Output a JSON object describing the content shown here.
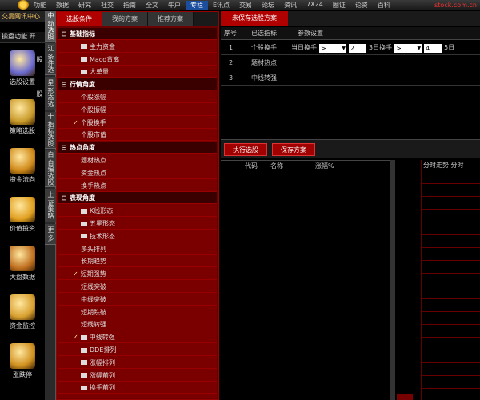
{
  "toolbar": {
    "items": [
      "功能",
      "数据",
      "研究",
      "社交",
      "指南",
      "全文",
      "牛户",
      "专栏",
      "E讯点",
      "交易",
      "论坛",
      "资讯",
      "7X24",
      "圈证",
      "论资",
      "百科"
    ],
    "active_index": 7,
    "brand": "stock.com.cn"
  },
  "left": {
    "title": "交易网讯中心",
    "subtitle": "操盘功能 开",
    "apps": [
      {
        "label": "选股设置",
        "icon": "diamond-icon",
        "color": "#6a6ad0"
      },
      {
        "label": "策略选股",
        "icon": "portfolio-icon",
        "color": "#c89a2a"
      },
      {
        "label": "资金流向",
        "icon": "coins-icon",
        "color": "#d08a1a"
      },
      {
        "label": "价值投资",
        "icon": "pe-icon",
        "color": "#e0a020"
      },
      {
        "label": "大盘数据",
        "icon": "calendar-icon",
        "color": "#c07020"
      },
      {
        "label": "资金监控",
        "icon": "money-icon",
        "color": "#d8a030"
      },
      {
        "label": "涨跌停",
        "icon": "gold-icon",
        "color": "#d09020"
      }
    ]
  },
  "vtabs": [
    "中 动选股",
    "江 条件选股",
    "星 形态选股",
    "十 指标选股",
    "白 自编选股",
    "上 证策略",
    "更 多"
  ],
  "panel": {
    "tabs": [
      "选股条件",
      "我的方案",
      "推荐方案"
    ],
    "tree": [
      {
        "type": "group",
        "label": "基础指标"
      },
      {
        "type": "leaf-folder",
        "label": "主力资金"
      },
      {
        "type": "leaf-folder",
        "label": "Macd背离"
      },
      {
        "type": "leaf-folder",
        "label": "大单量"
      },
      {
        "type": "group",
        "label": "行情角度"
      },
      {
        "type": "leaf",
        "label": "个股涨幅"
      },
      {
        "type": "leaf",
        "label": "个股振幅"
      },
      {
        "type": "leaf",
        "label": "个股换手",
        "checked": true
      },
      {
        "type": "leaf",
        "label": "个股市值"
      },
      {
        "type": "group",
        "label": "热点角度"
      },
      {
        "type": "leaf",
        "label": "题材热点"
      },
      {
        "type": "leaf",
        "label": "资金热点"
      },
      {
        "type": "leaf",
        "label": "换手热点"
      },
      {
        "type": "group",
        "label": "表现角度"
      },
      {
        "type": "leaf-folder",
        "label": "K线形态"
      },
      {
        "type": "leaf-folder",
        "label": "五星形态"
      },
      {
        "type": "leaf-folder",
        "label": "技术形态"
      },
      {
        "type": "leaf",
        "label": "多头排列"
      },
      {
        "type": "leaf",
        "label": "长期趋势"
      },
      {
        "type": "leaf",
        "label": "短期强势",
        "checked": true
      },
      {
        "type": "leaf",
        "label": "短线突破"
      },
      {
        "type": "leaf",
        "label": "中线突破"
      },
      {
        "type": "leaf",
        "label": "短期跌破"
      },
      {
        "type": "leaf",
        "label": "短线转强"
      },
      {
        "type": "leaf-folder",
        "label": "中线转强",
        "checked": true
      },
      {
        "type": "leaf-folder",
        "label": "DDE排列"
      },
      {
        "type": "leaf-folder",
        "label": "涨幅排列"
      },
      {
        "type": "leaf-folder",
        "label": "涨幅前列"
      },
      {
        "type": "leaf-folder",
        "label": "换手前列"
      }
    ]
  },
  "right": {
    "tab": "未保存选股方案",
    "columns": [
      "序号",
      "已选指标",
      "参数设置"
    ],
    "rows": [
      {
        "num": "1",
        "name": "个股换手",
        "params": {
          "l1": "当日换手",
          "op1": ">",
          "v1": "2",
          "l2": "3日换手",
          "op2": ">",
          "v2": "4",
          "l3": "5日"
        }
      },
      {
        "num": "2",
        "name": "题材热点",
        "params": null
      },
      {
        "num": "3",
        "name": "中线转强",
        "params": null
      }
    ],
    "buttons": [
      "执行选股",
      "保存方案"
    ],
    "result_cols": [
      "代码",
      "名称",
      "涨幅%"
    ],
    "side_cols": "分时走势 分时"
  }
}
